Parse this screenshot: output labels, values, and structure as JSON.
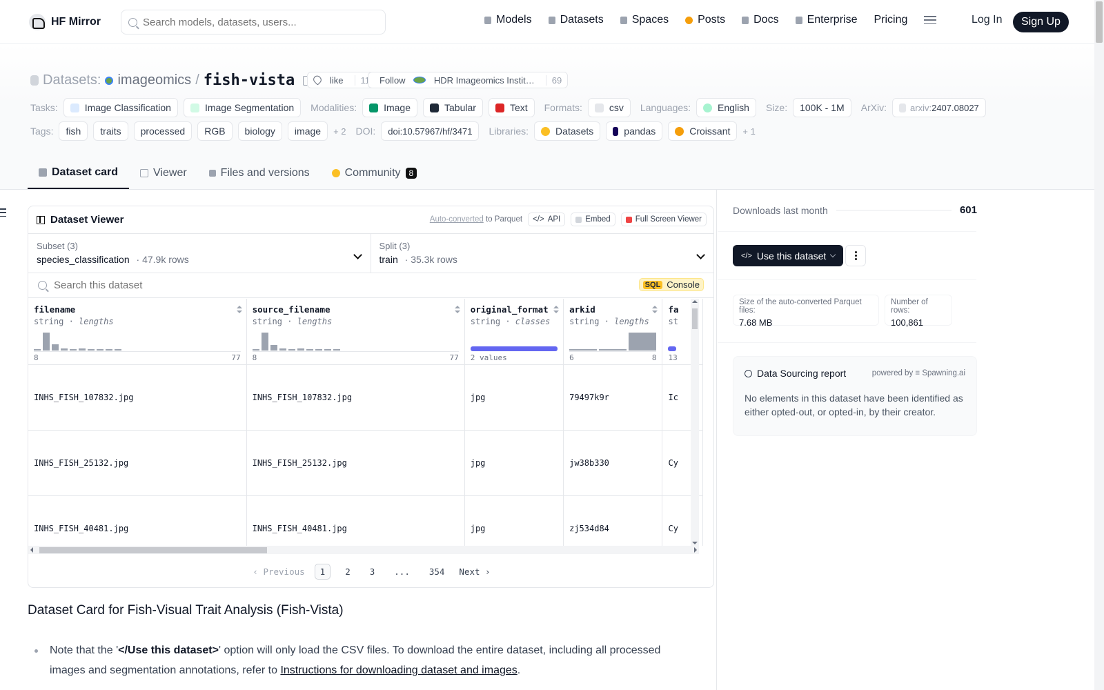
{
  "nav": {
    "brand": "HF Mirror",
    "search_placeholder": "Search models, datasets, users...",
    "links": [
      "Models",
      "Datasets",
      "Spaces",
      "Posts",
      "Docs",
      "Enterprise",
      "Pricing"
    ],
    "login": "Log In",
    "signup": "Sign Up"
  },
  "repo": {
    "type_label": "Datasets:",
    "org": "imageomics",
    "slash": "/",
    "name": "fish-vista",
    "like_label": "like",
    "like_count": "11",
    "follow_label": "Follow",
    "follow_org": "HDR Imageomics Instit…",
    "follow_count": "69"
  },
  "meta": {
    "tasks_label": "Tasks:",
    "tasks": [
      "Image Classification",
      "Image Segmentation"
    ],
    "modalities_label": "Modalities:",
    "modalities": [
      "Image",
      "Tabular",
      "Text"
    ],
    "formats_label": "Formats:",
    "formats": [
      "csv"
    ],
    "languages_label": "Languages:",
    "languages": [
      "English"
    ],
    "size_label": "Size:",
    "size": "100K - 1M",
    "arxiv_label": "ArXiv:",
    "arxiv_prefix": "arxiv:",
    "arxiv_id": "2407.08027",
    "tags_label": "Tags:",
    "tags": [
      "fish",
      "traits",
      "processed",
      "RGB",
      "biology",
      "image"
    ],
    "tags_more": "+ 2",
    "doi_label": "DOI:",
    "doi": "doi:10.57967/hf/3471",
    "libraries_label": "Libraries:",
    "libraries": [
      "Datasets",
      "pandas",
      "Croissant"
    ],
    "libraries_more": "+ 1"
  },
  "tabs": [
    {
      "label": "Dataset card",
      "active": true
    },
    {
      "label": "Viewer"
    },
    {
      "label": "Files and versions"
    },
    {
      "label": "Community",
      "badge": "8"
    }
  ],
  "viewer": {
    "title": "Dataset Viewer",
    "auto_converted": "Auto-converted",
    "to_parquet": "to Parquet",
    "api": "API",
    "embed": "Embed",
    "fullscreen": "Full Screen Viewer",
    "subset_label": "Subset (3)",
    "subset_value": "species_classification",
    "subset_rows": "47.9k rows",
    "split_label": "Split (3)",
    "split_value": "train",
    "split_rows": "35.3k rows",
    "search_placeholder": "Search this dataset",
    "sql_badge": "SQL",
    "console": "Console",
    "columns": [
      {
        "name": "filename",
        "type": "string",
        "stat": "lengths",
        "min": "8",
        "max": "77",
        "hist": [
          0.05,
          1.0,
          0.35,
          0.1,
          0.05,
          0.1,
          0.05,
          0.05,
          0.05,
          0.05
        ]
      },
      {
        "name": "source_filename",
        "type": "string",
        "stat": "lengths",
        "min": "8",
        "max": "77",
        "hist": [
          0.05,
          1.0,
          0.3,
          0.1,
          0.05,
          0.1,
          0.05,
          0.05,
          0.05,
          0.05
        ]
      },
      {
        "name": "original_format",
        "type": "string",
        "stat": "classes",
        "values_label": "2 values"
      },
      {
        "name": "arkid",
        "type": "string",
        "stat": "lengths",
        "min": "6",
        "max": "8",
        "hist": [
          0.05,
          0.05,
          1.0
        ]
      },
      {
        "name": "fa",
        "type": "st",
        "stat": "",
        "min": "13"
      }
    ],
    "rows": [
      [
        "INHS_FISH_107832.jpg",
        "INHS_FISH_107832.jpg",
        "jpg",
        "79497k9r",
        "Ic"
      ],
      [
        "INHS_FISH_25132.jpg",
        "INHS_FISH_25132.jpg",
        "jpg",
        "jw38b330",
        "Cy"
      ],
      [
        "INHS_FISH_40481.jpg",
        "INHS_FISH_40481.jpg",
        "jpg",
        "zj534d84",
        "Cy"
      ]
    ],
    "pager": {
      "prev": "Previous",
      "pages": [
        "1",
        "2",
        "3",
        "...",
        "354"
      ],
      "next": "Next",
      "current": "1"
    }
  },
  "card": {
    "title": "Dataset Card for Fish-Visual Trait Analysis (Fish-Vista)",
    "note_pre": "Note that the '",
    "note_bold": "</Use this dataset>",
    "note_mid": "' option will only load the CSV files. To download the entire dataset, including all processed images and segmentation annotations, refer to ",
    "note_link": "Instructions for downloading dataset and images",
    "note_end": "."
  },
  "sidebar": {
    "downloads_label": "Downloads last month",
    "downloads_value": "601",
    "use_button": "Use this dataset",
    "parquet_label": "Size of the auto-converted Parquet files:",
    "parquet_value": "7.68 MB",
    "rows_label": "Number of rows:",
    "rows_value": "100,861",
    "report_title": "Data Sourcing report",
    "powered_by": "powered by",
    "powered_name": "Spawning.ai",
    "report_body": "No elements in this dataset have been identified as either opted-out, or opted-in, by their creator."
  },
  "colors": {
    "accent": "#111827",
    "bar": "#9ca3af",
    "classbar": "#6366f1",
    "sql": "#fbbf24"
  }
}
